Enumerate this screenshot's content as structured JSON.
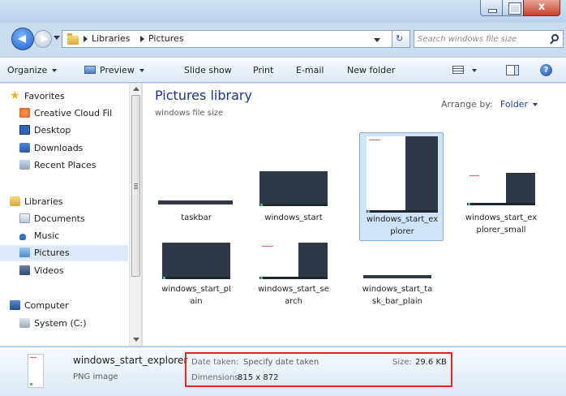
{
  "window": {
    "caption_buttons": {
      "close_glyph": "x"
    }
  },
  "address_bar": {
    "breadcrumbs": [
      "Libraries",
      "Pictures"
    ],
    "refresh_glyph": "↻"
  },
  "search": {
    "placeholder": "Search windows file size"
  },
  "toolbar": {
    "organize": "Organize",
    "preview": "Preview",
    "slide_show": "Slide show",
    "print": "Print",
    "email": "E-mail",
    "new_folder": "New folder",
    "help_glyph": "?"
  },
  "nav": {
    "favorites": {
      "label": "Favorites",
      "items": [
        "Creative Cloud Fil",
        "Desktop",
        "Downloads",
        "Recent Places"
      ]
    },
    "libraries": {
      "label": "Libraries",
      "items": [
        "Documents",
        "Music",
        "Pictures",
        "Videos"
      ]
    },
    "computer": {
      "label": "Computer",
      "items": [
        "System (C:)"
      ]
    },
    "selected": "Pictures"
  },
  "content": {
    "title": "Pictures library",
    "subtitle": "windows file size",
    "arrange_label": "Arrange by:",
    "arrange_value": "Folder",
    "files": [
      {
        "name_lines": [
          "taskbar"
        ]
      },
      {
        "name_lines": [
          "windows_start"
        ]
      },
      {
        "name_lines": [
          "windows_start_ex",
          "plorer"
        ],
        "selected": true
      },
      {
        "name_lines": [
          "windows_start_ex",
          "plorer_small"
        ]
      },
      {
        "name_lines": [
          "windows_start_pl",
          "ain"
        ]
      },
      {
        "name_lines": [
          "windows_start_se",
          "arch"
        ]
      },
      {
        "name_lines": [
          "windows_start_ta",
          "sk_bar_plain"
        ]
      }
    ]
  },
  "details": {
    "file_name": "windows_start_explorer",
    "file_type": "PNG image",
    "date_taken_label": "Date taken:",
    "date_taken_value": "Specify date taken",
    "size_label": "Size:",
    "size_value": "29.6 KB",
    "dimensions_label": "Dimensions:",
    "dimensions_value": "815 x 872"
  },
  "colors": {
    "accent_title": "#1e3287",
    "selection_bg": "#cde4fb",
    "highlight_box": "#e0252b"
  }
}
